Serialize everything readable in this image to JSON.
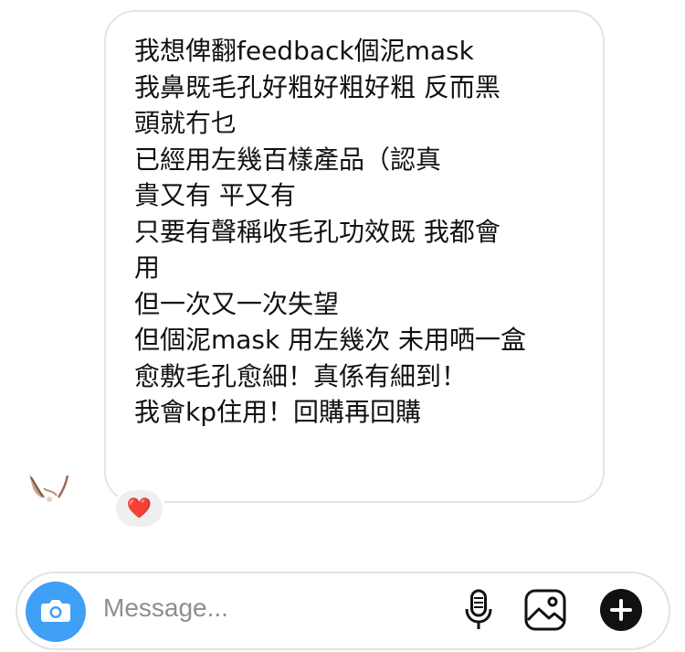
{
  "message": {
    "lines": [
      "我想俾翻feedback個泥mask",
      "我鼻既毛孔好粗好粗好粗 反而黑",
      "頭就冇乜",
      "已經用左幾百樣產品（認真",
      "貴又有 平又有",
      "只要有聲稱收毛孔功效既 我都會",
      "用",
      "但一次又一次失望",
      "但個泥mask 用左幾次 未用哂一盒",
      "愈敷毛孔愈細！真係有細到！",
      "我會kp住用！回購再回購"
    ],
    "reaction": "❤️"
  },
  "composer": {
    "placeholder": "Message..."
  },
  "icons": {
    "camera": "camera-icon",
    "mic": "microphone-icon",
    "gallery": "gallery-icon",
    "plus": "plus-icon"
  },
  "colors": {
    "camera_bg": "#3f9ff5",
    "reaction_heart": "#e3262f",
    "plus_bg": "#111111"
  }
}
